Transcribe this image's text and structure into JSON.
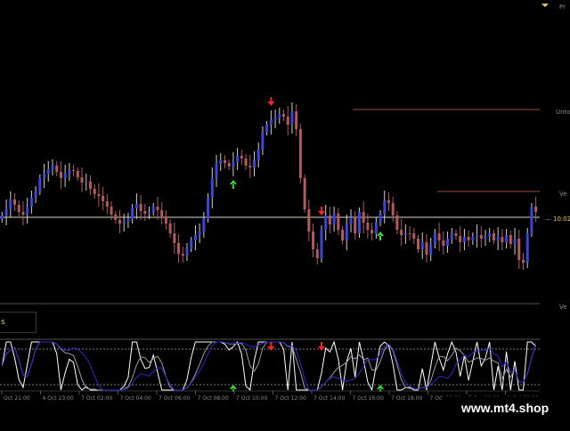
{
  "colors": {
    "background": "#000000",
    "bull_candle": "#3a46d8",
    "bear_candle": "#b45a5a",
    "wick": "#cfcfcf",
    "price_line": "#d8d8c8",
    "level_line": "#9a4a4a",
    "up_arrow": "#33dd33",
    "down_arrow": "#ff2222",
    "osc_fast": "#ffffff",
    "osc_slow": "#2c2cc8",
    "osc_mid": "#9a9aa8",
    "axis_text": "#8a8a8a",
    "dotted_level": "#7a7a7a"
  },
  "price_axis": {
    "top_label": "Pr",
    "level_labels": [
      "Unto",
      "Ve",
      "Ve"
    ],
    "current_price": "10:02"
  },
  "info_box": {
    "text": "s"
  },
  "time_axis": {
    "labels": [
      "Oct 21:00",
      "4 Oct 23:00",
      "7 Oct 02:00",
      "7 Oct 04:00",
      "7 Oct 06:00",
      "7 Oct 08:00",
      "7 Oct 10:00",
      "7 Oct 12:00",
      "7 Oct 14:00",
      "7 Oct 16:00",
      "7 Oct 18:00",
      "7 Oct 20:00",
      "7 Oct 22:00",
      "8 Oct 00:00",
      "8 Oct 02:00"
    ]
  },
  "price_series": [
    242,
    235,
    224,
    230,
    238,
    241,
    232,
    222,
    215,
    200,
    195,
    190,
    186,
    193,
    200,
    195,
    191,
    192,
    199,
    205,
    204,
    212,
    218,
    220,
    226,
    232,
    241,
    247,
    251,
    249,
    246,
    234,
    229,
    237,
    240,
    238,
    232,
    236,
    243,
    251,
    262,
    273,
    285,
    287,
    279,
    270,
    264,
    260,
    245,
    222,
    200,
    184,
    180,
    183,
    187,
    182,
    175,
    178,
    186,
    188,
    180,
    168,
    148,
    140,
    135,
    132,
    128,
    131,
    140,
    125,
    145,
    200,
    235,
    260,
    280,
    290,
    258,
    242,
    252,
    240,
    258,
    270,
    252,
    244,
    262,
    238,
    250,
    258,
    262,
    250,
    240,
    225,
    228,
    242,
    258,
    264,
    262,
    262,
    268,
    280,
    272,
    286,
    274,
    262,
    270,
    276,
    268,
    262,
    265,
    272,
    266,
    270,
    266,
    264,
    268,
    266,
    262,
    270,
    266,
    272,
    264,
    274,
    268,
    292,
    295,
    262,
    232,
    238
  ],
  "arrows": [
    {
      "dir": "down",
      "bar": 64
    },
    {
      "dir": "down",
      "bar": 76
    },
    {
      "dir": "up",
      "bar": 55
    },
    {
      "dir": "up",
      "bar": 90
    }
  ],
  "levels": [
    {
      "bars": [
        84,
        152
      ],
      "price": 123
    },
    {
      "bars": [
        104,
        152
      ],
      "price": 215
    },
    {
      "bars": [
        0,
        152
      ],
      "price": 244
    },
    {
      "bars": [
        0,
        152
      ],
      "price": 341
    }
  ],
  "oscillator": {
    "upper_level": 392,
    "lower_level": 432
  }
}
